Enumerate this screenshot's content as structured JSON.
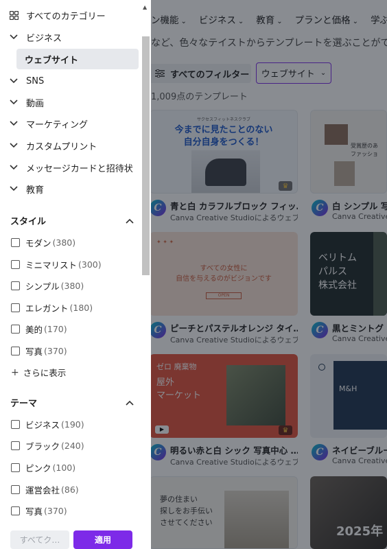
{
  "nav": {
    "items": [
      "ン機能",
      "ビジネス",
      "教育",
      "プランと価格",
      "学ぶ"
    ]
  },
  "hero_text": "など、色々なテイストからテンプレートを選ぶことがで",
  "filters": {
    "all_filters_label": "すべてのフィルター",
    "chip_label": "ウェブサイト",
    "count_text": "1,009点のテンプレート"
  },
  "cards": [
    {
      "title": "青と白 カラフルブロック フィッ…",
      "subtitle": "Canva Creative Studioによるウェブ…",
      "thumb_heading": "今までに見たことのない\n自分自身をつくる！",
      "thumb_small": "サクセスフィットネスクラブ"
    },
    {
      "title": "白 シンプル 写",
      "subtitle": "Canva Creative",
      "thumb_heading": "受賞歴のあ\nファッショ"
    },
    {
      "title": "ピーチとパステルオレンジ タイ…",
      "subtitle": "Canva Creative Studioによるウェブ…",
      "thumb_heading": "すべての女性に\n自信を与えるのがビジョンです",
      "thumb_small": "OPEN"
    },
    {
      "title": "黒とミントグ",
      "subtitle": "Canva Creative",
      "thumb_heading": "ベリトム\nパルス\n株式会社"
    },
    {
      "title": "明るい赤と白 シック 写真中心 …",
      "subtitle": "Canva Creative Studioによるウェブ…",
      "thumb_heading": "屋外\nマーケット",
      "thumb_small": "ゼロ 廃棄物"
    },
    {
      "title": "ネイビーブルー",
      "subtitle": "Canva Creative",
      "thumb_heading": "M&H"
    },
    {
      "title": "",
      "subtitle": "",
      "thumb_heading": "夢の住まい\n探しをお手伝い\nさせてください"
    },
    {
      "title": "",
      "subtitle": "",
      "thumb_heading": "2025年"
    }
  ],
  "panel": {
    "all_categories": "すべてのカテゴリー",
    "categories": [
      "ビジネス",
      "SNS",
      "動画",
      "マーケティング",
      "カスタムプリント",
      "メッセージカードと招待状",
      "教育"
    ],
    "selected_subcategory": "ウェブサイト",
    "style_section": {
      "title": "スタイル",
      "options": [
        {
          "label": "モダン",
          "count": "(380)"
        },
        {
          "label": "ミニマリスト",
          "count": "(300)"
        },
        {
          "label": "シンプル",
          "count": "(380)"
        },
        {
          "label": "エレガント",
          "count": "(180)"
        },
        {
          "label": "美的",
          "count": "(170)"
        },
        {
          "label": "写真",
          "count": "(370)"
        }
      ],
      "more_label": "さらに表示"
    },
    "theme_section": {
      "title": "テーマ",
      "options": [
        {
          "label": "ビジネス",
          "count": "(190)"
        },
        {
          "label": "ブラック",
          "count": "(240)"
        },
        {
          "label": "ピンク",
          "count": "(100)"
        },
        {
          "label": "運営会社",
          "count": "(86)"
        },
        {
          "label": "写真",
          "count": "(370)"
        }
      ]
    },
    "footer": {
      "clear_label": "すべてク…",
      "apply_label": "適用"
    }
  },
  "colors": {
    "accent": "#7d2ae8",
    "overlay": "rgba(20,25,35,0.5)"
  },
  "icons": {
    "grid": "grid-icon",
    "chevron": "chevron-down-icon",
    "collapse": "chevron-up-icon",
    "filter": "sliders-icon"
  }
}
